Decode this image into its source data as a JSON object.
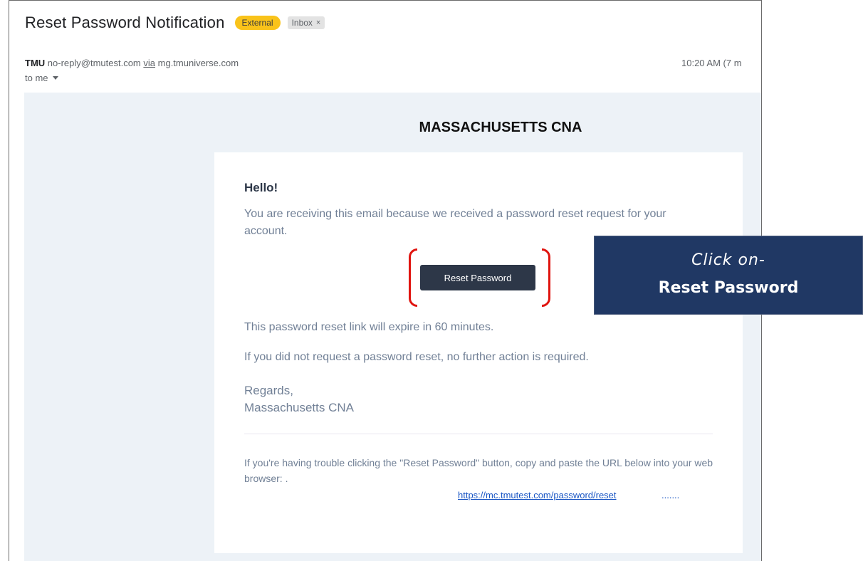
{
  "email": {
    "subject": "Reset Password Notification",
    "labels": {
      "external": "External",
      "inbox": "Inbox",
      "inbox_remove": "×"
    },
    "sender": {
      "name": "TMU",
      "address": "no-reply@tmutest.com",
      "via_label": "via",
      "via_domain": "mg.tmuniverse.com"
    },
    "recipient": "to me",
    "timestamp": "10:20 AM (7 m"
  },
  "message": {
    "brand_title": "MASSACHUSETTS CNA",
    "greeting": "Hello!",
    "intro": "You are receiving this email because we received a password reset request for your account.",
    "button_label": "Reset Password",
    "expiry_note": "This password reset link will expire in 60 minutes.",
    "no_action_note": "If you did not request a password reset, no further action is required.",
    "regards": "Regards,",
    "signature": "Massachusetts CNA",
    "trouble_text": "If you're having trouble clicking the \"Reset Password\" button, copy and paste the URL below into your web browser:",
    "trouble_text_suffix": ".",
    "reset_url": "https://mc.tmutest.com/password/reset",
    "url_ellipsis": "......."
  },
  "callout": {
    "line1": "Click on-",
    "line2": "Reset Password"
  },
  "colors": {
    "button_bg": "#2d3748",
    "highlight_bracket": "#e0140f",
    "callout_bg": "#203864",
    "external_chip": "#f9c31a",
    "mail_background": "#edf2f7"
  }
}
